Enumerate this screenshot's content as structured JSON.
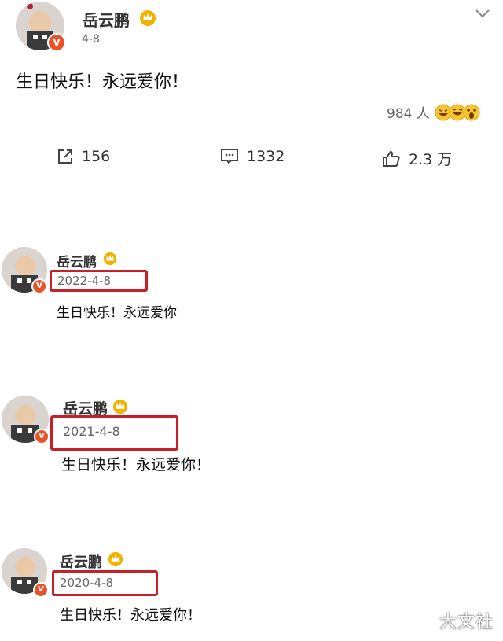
{
  "post": {
    "author": "岳云鹏",
    "date": "4-8",
    "text": "生日快乐！永远爱你！",
    "reactions_label": "984 人",
    "reaction_icons": [
      "grin-emoji-icon",
      "laugh-emoji-icon",
      "surprised-emoji-icon"
    ],
    "share_count": "156",
    "comment_count": "1332",
    "like_count": "2.3 万",
    "verified_badge": "V"
  },
  "history": [
    {
      "author": "岳云鹏",
      "date": "2022-4-8",
      "text": "生日快乐！永远爱你",
      "verified_badge": "V"
    },
    {
      "author": "岳云鹏",
      "date": "2021-4-8",
      "text": "生日快乐！永远爱你！",
      "verified_badge": "V"
    },
    {
      "author": "岳云鹏",
      "date": "2020-4-8",
      "text": "生日快乐！永远爱你！",
      "verified_badge": "V"
    }
  ],
  "watermark": "大文社",
  "colors": {
    "highlight_box": "#c8202a",
    "verified_badge": "#e8542a",
    "crown": "#f2b300"
  }
}
